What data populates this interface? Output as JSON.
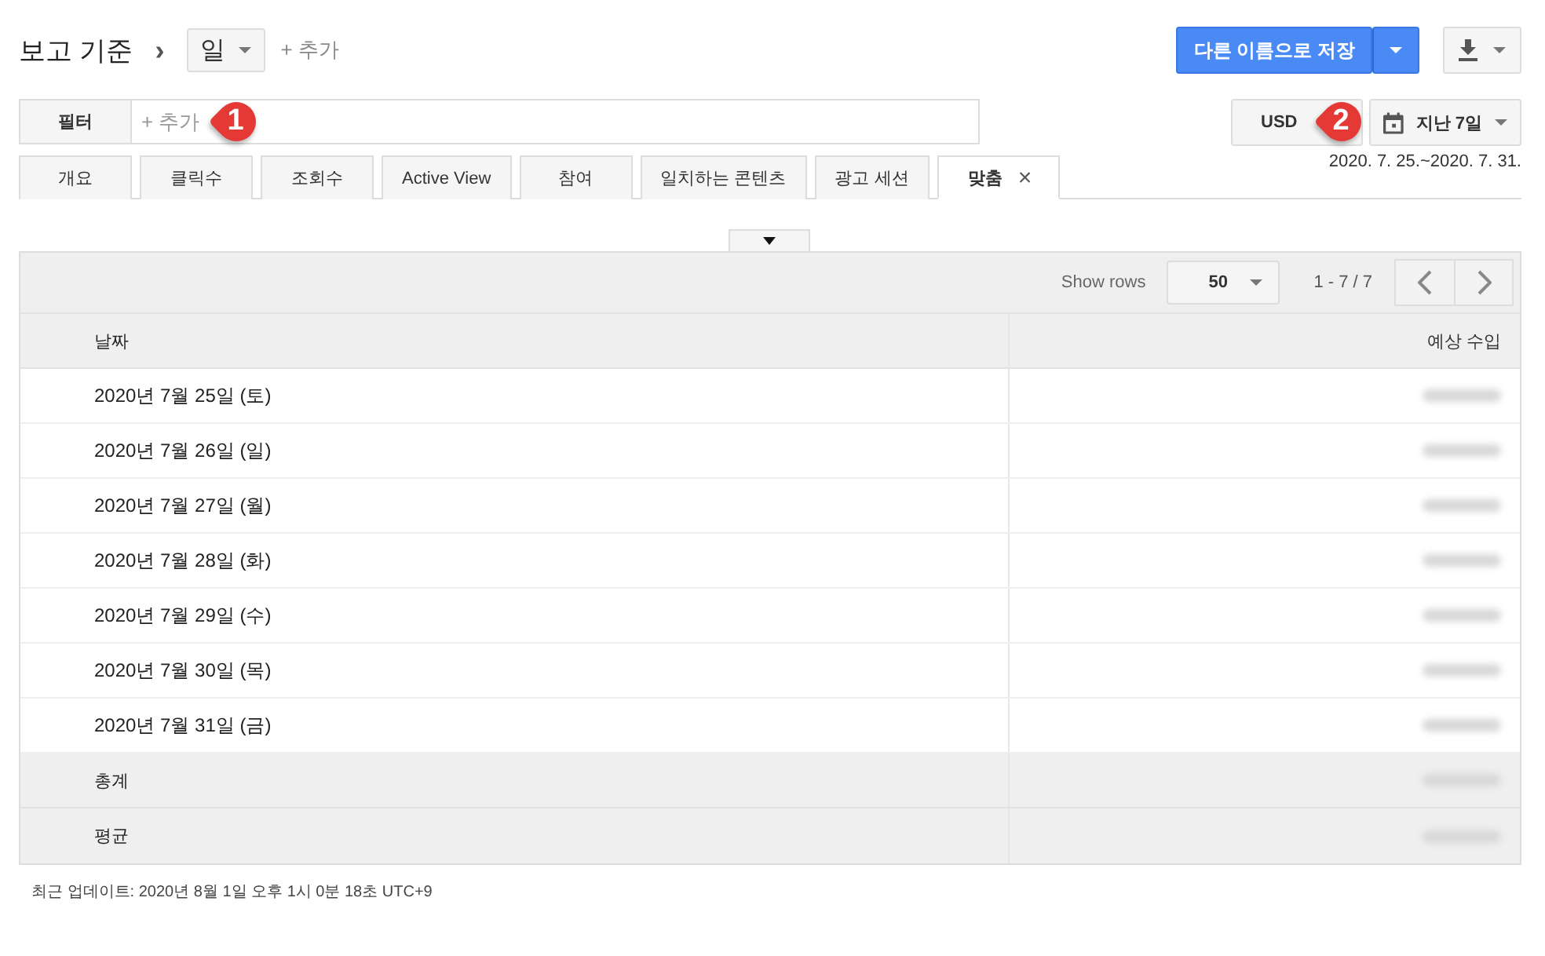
{
  "breadcrumb": {
    "title": "보고 기준",
    "separator": "›",
    "dimension": "일",
    "add": "+ 추가"
  },
  "actions": {
    "save_as": "다른 이름으로 저장"
  },
  "filter": {
    "label": "필터",
    "placeholder": "+ 추가"
  },
  "currency": "USD",
  "date_range": {
    "label": "지난 7일",
    "dates": "2020. 7. 25.~2020. 7. 31."
  },
  "callouts": [
    {
      "label": "1"
    },
    {
      "label": "2"
    }
  ],
  "tabs": [
    {
      "label": "개요",
      "selected": false
    },
    {
      "label": "클릭수",
      "selected": false
    },
    {
      "label": "조회수",
      "selected": false
    },
    {
      "label": "Active View",
      "selected": false
    },
    {
      "label": "참여",
      "selected": false
    },
    {
      "label": "일치하는 콘텐츠",
      "selected": false
    },
    {
      "label": "광고 세션",
      "selected": false
    },
    {
      "label": "맞춤",
      "selected": true,
      "close": "×"
    }
  ],
  "table": {
    "show_rows_label": "Show rows",
    "rows_per_page": "50",
    "range": "1 - 7 / 7",
    "columns": [
      "날짜",
      "예상 수입"
    ],
    "rows": [
      {
        "date": "2020년 7월 25일 (토)",
        "redacted": true
      },
      {
        "date": "2020년 7월 26일 (일)",
        "redacted": true
      },
      {
        "date": "2020년 7월 27일 (월)",
        "redacted": true
      },
      {
        "date": "2020년 7월 28일 (화)",
        "redacted": true
      },
      {
        "date": "2020년 7월 29일 (수)",
        "redacted": true
      },
      {
        "date": "2020년 7월 30일 (목)",
        "redacted": true
      },
      {
        "date": "2020년 7월 31일 (금)",
        "redacted": true
      }
    ],
    "summary": [
      {
        "label": "총계",
        "redacted": true
      },
      {
        "label": "평균",
        "redacted": true
      }
    ]
  },
  "status_bar": "최근 업데이트: 2020년 8월 1일 오후 1시 0분 18초 UTC+9"
}
